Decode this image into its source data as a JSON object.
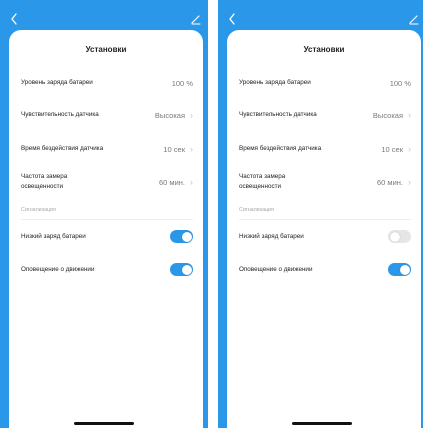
{
  "colors": {
    "accent": "#2b97e8",
    "toggle_off": "#e6e6e6",
    "secondary_text": "#7a7a7a"
  },
  "screens": [
    {
      "title": "Установки",
      "rows": {
        "battery_level": {
          "label": "Уровень заряда батареи",
          "value": "100 %"
        },
        "sensitivity": {
          "label": "Чувствительность датчика",
          "value": "Высокая"
        },
        "idle_time": {
          "label": "Время бездействия датчика",
          "value": "10 сек"
        },
        "light_freq": {
          "label_line1": "Частота замера",
          "label_line2": "освещенности",
          "value": "60 мин."
        }
      },
      "section_label": "Сигнализация",
      "toggles": {
        "low_battery": {
          "label": "Низкий заряд батареи",
          "state": "on"
        },
        "motion_alert": {
          "label": "Оповещение о движении",
          "state": "on"
        }
      }
    },
    {
      "title": "Установки",
      "rows": {
        "battery_level": {
          "label": "Уровень заряда батареи",
          "value": "100 %"
        },
        "sensitivity": {
          "label": "Чувствительность датчика",
          "value": "Высокая"
        },
        "idle_time": {
          "label": "Время бездействия датчика",
          "value": "10 сек"
        },
        "light_freq": {
          "label_line1": "Частота замера",
          "label_line2": "освещенности",
          "value": "60 мин."
        }
      },
      "section_label": "Сигнализация",
      "toggles": {
        "low_battery": {
          "label": "Низкий заряд батареи",
          "state": "off"
        },
        "motion_alert": {
          "label": "Оповещение о движении",
          "state": "on"
        }
      }
    }
  ],
  "icons": {
    "back": "chevron-left-icon",
    "edit": "pencil-icon",
    "row_arrow": "chevron-right-icon"
  }
}
